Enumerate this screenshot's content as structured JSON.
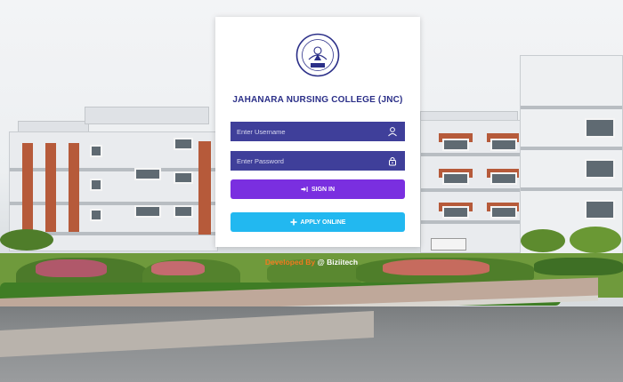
{
  "college": {
    "title": "JAHANARA NURSING COLLEGE (JNC)",
    "logo_icon": "college-seal-icon"
  },
  "login": {
    "username_placeholder": "Enter Username",
    "password_placeholder": "Enter Password",
    "username_icon": "user-icon",
    "password_icon": "lock-icon",
    "signin_label": "SIGN IN",
    "signin_icon": "sign-in-icon",
    "apply_label": "APPLY ONLINE",
    "apply_icon": "plus-icon"
  },
  "footer": {
    "developed_by": "Developed By",
    "company": "@ Biziitech"
  },
  "colors": {
    "title": "#2b2f88",
    "field_bg": "#3f3f9a",
    "signin_bg": "#7a2fe0",
    "apply_bg": "#22b8f0",
    "footer_accent": "#f07a1f"
  }
}
